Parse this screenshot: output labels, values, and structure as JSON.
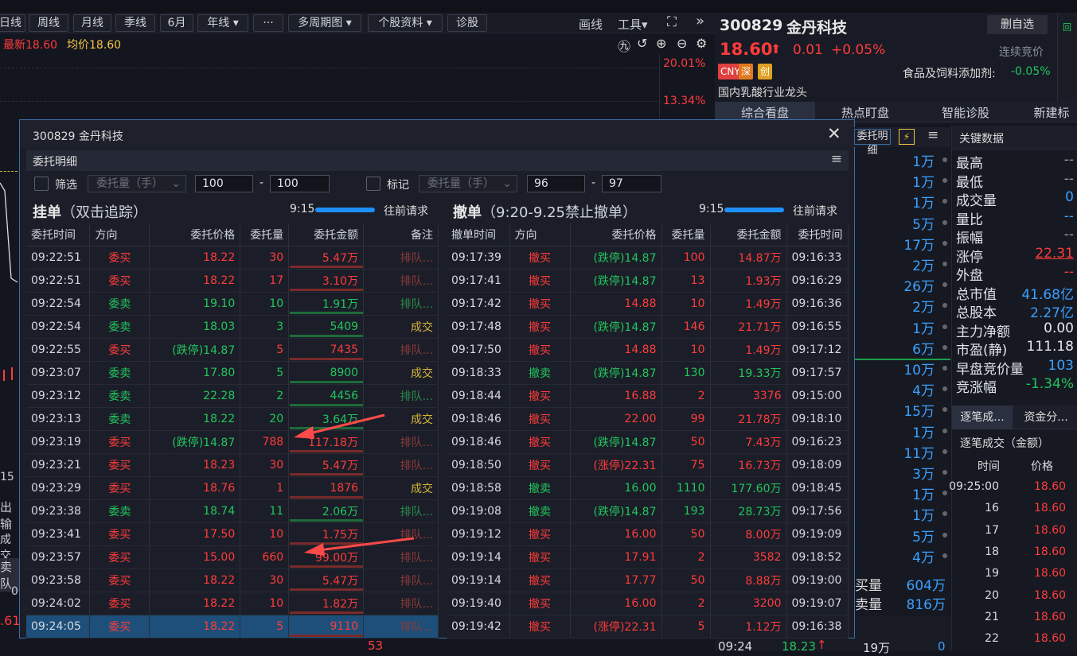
{
  "toolbar": {
    "buttons": [
      "日线",
      "周线",
      "月线",
      "季线",
      "6月",
      "年线 ▾",
      "···",
      "多周期图 ▾",
      "个股资料 ▾",
      "诊股"
    ],
    "draw": "画线",
    "tools": "工具▾"
  },
  "pricebar": {
    "latest_label": "最新",
    "latest": "18.60",
    "avg_label": "均价",
    "avg": "18.60"
  },
  "chart_pct": [
    "20.01%",
    "13.34%"
  ],
  "stock": {
    "code": "300829",
    "name": "金丹科技",
    "delete_btn": "删自选",
    "price": "18.60",
    "arrow": "⬆",
    "change": "0.01",
    "change_pct": "+0.05%",
    "status": "连续竞价",
    "tags": [
      "CNY",
      "深",
      "创"
    ],
    "sector": "食品及饲料添加剂:",
    "sector_pct": "-0.05%",
    "concept": "国内乳酸行业龙头"
  },
  "tabs": [
    "综合看盘",
    "热点盯盘",
    "智能诊股",
    "新建标"
  ],
  "key_data": {
    "title": "关键数据",
    "rows": [
      {
        "label": "最高",
        "value": "--",
        "cls": "gr"
      },
      {
        "label": "最低",
        "value": "--",
        "cls": "gr"
      },
      {
        "label": "成交量",
        "value": "0",
        "cls": "bl"
      },
      {
        "label": "量比",
        "value": "--",
        "cls": "bl"
      },
      {
        "label": "振幅",
        "value": "--",
        "cls": "gr"
      },
      {
        "label": "涨停",
        "value": "22.31",
        "cls": "up"
      },
      {
        "label": "外盘",
        "value": "--",
        "cls": "up"
      },
      {
        "label": "总市值",
        "value": "41.68亿",
        "cls": "bl"
      },
      {
        "label": "总股本",
        "value": "2.27亿",
        "cls": "bl"
      },
      {
        "label": "主力净额",
        "value": "0.00",
        "cls": "wh"
      },
      {
        "label": "市盈(静)",
        "value": "111.18",
        "cls": "wh"
      },
      {
        "label": "早盘竞价量",
        "value": "103",
        "cls": "bl"
      },
      {
        "label": "竞涨幅",
        "value": "-1.34%",
        "cls": "dn"
      }
    ],
    "tab1": "逐笔成...",
    "tab2": "资金分...",
    "ticks_title": "逐笔成交（金额）",
    "ticks_head": [
      "时间",
      "价格"
    ],
    "ticks": [
      [
        "09:25:00",
        "18.60"
      ],
      [
        "16",
        "18.60"
      ],
      [
        "17",
        "18.60"
      ],
      [
        "18",
        "18.60"
      ],
      [
        "19",
        "18.60"
      ],
      [
        "20",
        "18.60"
      ],
      [
        "21",
        "18.60"
      ],
      [
        "22",
        "18.60"
      ]
    ]
  },
  "volume_col": [
    "1万",
    "1万",
    "1万",
    "5万",
    "17万",
    "2万",
    "26万",
    "2万",
    "1万",
    "6万",
    "10万",
    "4万",
    "15万",
    "1万",
    "11万",
    "3万",
    "1万",
    "1万",
    "5万",
    "4万"
  ],
  "volume_summary": [
    {
      "label": "买量",
      "value": "604万"
    },
    {
      "label": "卖量",
      "value": "816万"
    }
  ],
  "bottom": {
    "time": "09:24",
    "price": "18.23",
    "arrow": "↑",
    "vol": "19万",
    "n": "0",
    "left_num": "53"
  },
  "dialog": {
    "title": "300829 金丹科技",
    "subtitle": "委托明细",
    "detail_btn": "委托明细",
    "filter": {
      "label": "筛选",
      "field": "委托量（手）",
      "min": "100",
      "max": "100",
      "dash": "-"
    },
    "mark": {
      "label": "标记",
      "field": "委托量（手）",
      "min": "96",
      "max": "97",
      "dash": "-"
    },
    "left": {
      "title": "挂单",
      "subtitle": "（双击追踪）",
      "time": "9:15",
      "prev": "往前请求",
      "headers": [
        "委托时间",
        "方向",
        "委托价格",
        "委托量",
        "委托金额",
        "备注"
      ],
      "rows": [
        [
          "09:22:51",
          "委买",
          "18.22",
          "30",
          "5.47万",
          "排队..."
        ],
        [
          "09:22:51",
          "委买",
          "18.22",
          "17",
          "3.10万",
          "排队..."
        ],
        [
          "09:22:54",
          "委卖",
          "19.10",
          "10",
          "1.91万",
          "排队..."
        ],
        [
          "09:22:54",
          "委卖",
          "18.03",
          "3",
          "5409",
          "成交"
        ],
        [
          "09:22:55",
          "委买",
          "(跌停)14.87",
          "5",
          "7435",
          "排队..."
        ],
        [
          "09:23:07",
          "委卖",
          "17.80",
          "5",
          "8900",
          "成交"
        ],
        [
          "09:23:12",
          "委卖",
          "22.28",
          "2",
          "4456",
          "排队..."
        ],
        [
          "09:23:13",
          "委卖",
          "18.22",
          "20",
          "3.64万",
          "成交"
        ],
        [
          "09:23:19",
          "委买",
          "(跌停)14.87",
          "788",
          "117.18万",
          "排队..."
        ],
        [
          "09:23:21",
          "委买",
          "18.23",
          "30",
          "5.47万",
          "排队..."
        ],
        [
          "09:23:29",
          "委买",
          "18.76",
          "1",
          "1876",
          "成交"
        ],
        [
          "09:23:38",
          "委卖",
          "18.74",
          "11",
          "2.06万",
          "排队..."
        ],
        [
          "09:23:41",
          "委买",
          "17.50",
          "10",
          "1.75万",
          "排队..."
        ],
        [
          "09:23:57",
          "委买",
          "15.00",
          "660",
          "99.00万",
          "排队..."
        ],
        [
          "09:23:58",
          "委买",
          "18.22",
          "30",
          "5.47万",
          "排队..."
        ],
        [
          "09:24:02",
          "委买",
          "18.22",
          "10",
          "1.82万",
          "排队..."
        ],
        [
          "09:24:05",
          "委买",
          "18.22",
          "5",
          "9110",
          "排队..."
        ]
      ]
    },
    "right": {
      "title": "撤单",
      "subtitle": "（9:20-9.25禁止撤单）",
      "time": "9:15",
      "prev": "往前请求",
      "headers": [
        "撤单时间",
        "方向",
        "委托价格",
        "委托量",
        "委托金额",
        "委托时间"
      ],
      "rows": [
        [
          "09:17:39",
          "撤买",
          "(跌停)14.87",
          "100",
          "14.87万",
          "09:16:33"
        ],
        [
          "09:17:41",
          "撤买",
          "(跌停)14.87",
          "13",
          "1.93万",
          "09:16:29"
        ],
        [
          "09:17:42",
          "撤买",
          "14.88",
          "10",
          "1.49万",
          "09:16:36"
        ],
        [
          "09:17:48",
          "撤买",
          "(跌停)14.87",
          "146",
          "21.71万",
          "09:16:55"
        ],
        [
          "09:17:50",
          "撤买",
          "14.88",
          "10",
          "1.49万",
          "09:17:12"
        ],
        [
          "09:18:33",
          "撤卖",
          "(跌停)14.87",
          "130",
          "19.33万",
          "09:17:57"
        ],
        [
          "09:18:44",
          "撤买",
          "16.88",
          "2",
          "3376",
          "09:15:00"
        ],
        [
          "09:18:46",
          "撤买",
          "22.00",
          "99",
          "21.78万",
          "09:18:10"
        ],
        [
          "09:18:46",
          "撤买",
          "(跌停)14.87",
          "50",
          "7.43万",
          "09:16:23"
        ],
        [
          "09:18:50",
          "撤买",
          "(涨停)22.31",
          "75",
          "16.73万",
          "09:18:09"
        ],
        [
          "09:18:58",
          "撤卖",
          "16.00",
          "1110",
          "177.60万",
          "09:18:45"
        ],
        [
          "09:19:08",
          "撤卖",
          "(跌停)14.87",
          "193",
          "28.73万",
          "09:17:56"
        ],
        [
          "09:19:12",
          "撤买",
          "16.00",
          "50",
          "8.00万",
          "09:19:09"
        ],
        [
          "09:19:14",
          "撤买",
          "17.91",
          "2",
          "3582",
          "09:18:52"
        ],
        [
          "09:19:14",
          "撤买",
          "17.77",
          "50",
          "8.88万",
          "09:19:00"
        ],
        [
          "09:19:40",
          "撤买",
          "16.00",
          "2",
          "3200",
          "09:19:07"
        ],
        [
          "09:19:42",
          "撤买",
          "(涨停)22.31",
          "5",
          "1.12万",
          "09:16:38"
        ]
      ]
    }
  },
  "colors": {
    "up": "#ff3b3b",
    "down": "#22c55e",
    "accent": "#1e90ff",
    "selected": "#1d4f7a"
  },
  "left_edge": [
    "15",
    "出输",
    "成交",
    "卖队",
    "0",
    ".61"
  ]
}
